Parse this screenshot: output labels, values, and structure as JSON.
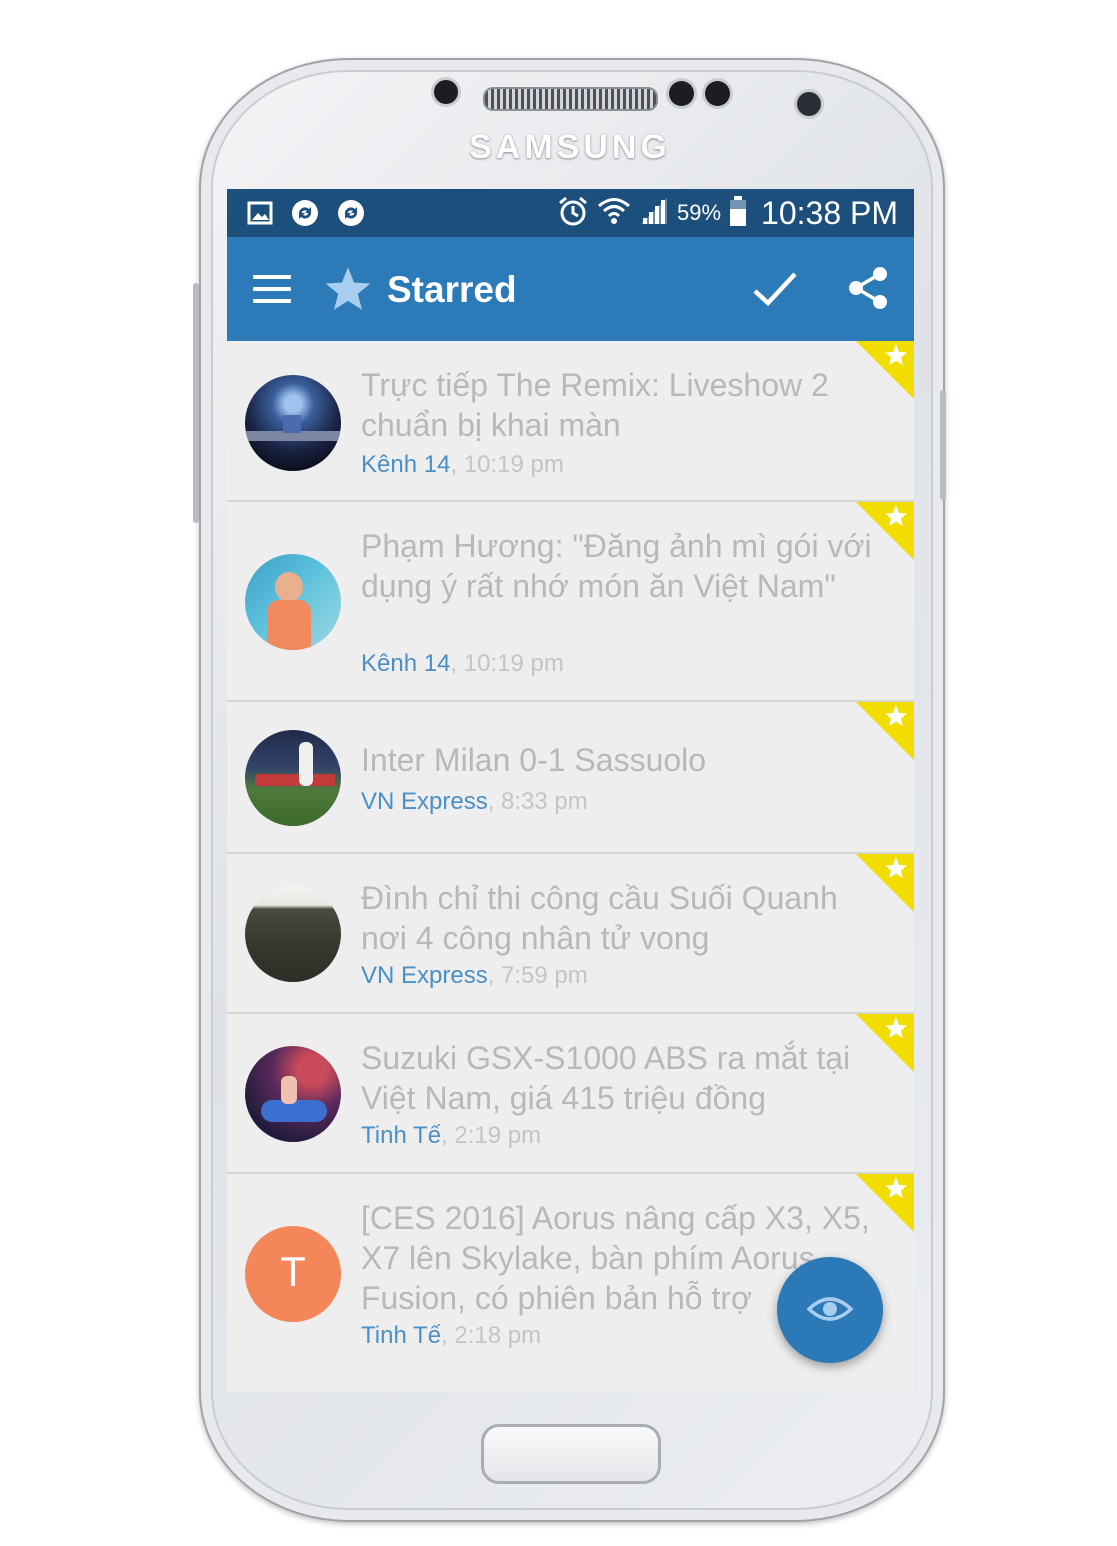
{
  "device": {
    "brand": "SAMSUNG"
  },
  "status_bar": {
    "left_icons": [
      "gallery-icon",
      "sync-icon",
      "sync-icon"
    ],
    "right_icons": [
      "alarm-icon",
      "wifi-icon",
      "signal-icon",
      "battery-icon"
    ],
    "battery": "59%",
    "time": "10:38 PM"
  },
  "app_bar": {
    "title": "Starred",
    "title_icon": "star-icon",
    "actions": [
      "menu-icon",
      "check-icon",
      "share-icon"
    ]
  },
  "colors": {
    "status_bar": "#1d4f7c",
    "app_bar": "#2c7ab8",
    "source_text": "#4b8fc7",
    "starred_corner": "#f1dd00",
    "fab": "#2b79b7",
    "avatar_letter_bg": "#f3875a"
  },
  "items": [
    {
      "title": "Trực tiếp The Remix: Liveshow 2 chuẩn bị khai màn",
      "source": "Kênh 14",
      "time": ", 10:19 pm"
    },
    {
      "title": "Phạm Hương: \"Đăng ảnh mì gói với dụng ý rất nhớ món ăn Việt Nam\"",
      "source": "Kênh 14",
      "time": ", 10:19 pm"
    },
    {
      "title": "Inter Milan 0-1 Sassuolo",
      "source": "VN Express",
      "time": ", 8:33 pm"
    },
    {
      "title": "Đình chỉ thi công cầu Suối Quanh nơi 4 công nhân tử vong",
      "source": "VN Express",
      "time": ", 7:59 pm"
    },
    {
      "title": "Suzuki GSX-S1000 ABS ra mắt tại Việt Nam, giá 415 triệu đồng",
      "source": "Tinh Tế",
      "time": ", 2:19 pm"
    },
    {
      "title": "[CES 2016] Aorus nâng cấp X3, X5, X7 lên Skylake, bàn phím Aorus Fusion, có phiên bản hỗ trợ",
      "source": "Tinh Tế",
      "time": ", 2:18 pm",
      "avatar_letter": "T"
    }
  ],
  "fab": {
    "icon": "eye-icon"
  }
}
